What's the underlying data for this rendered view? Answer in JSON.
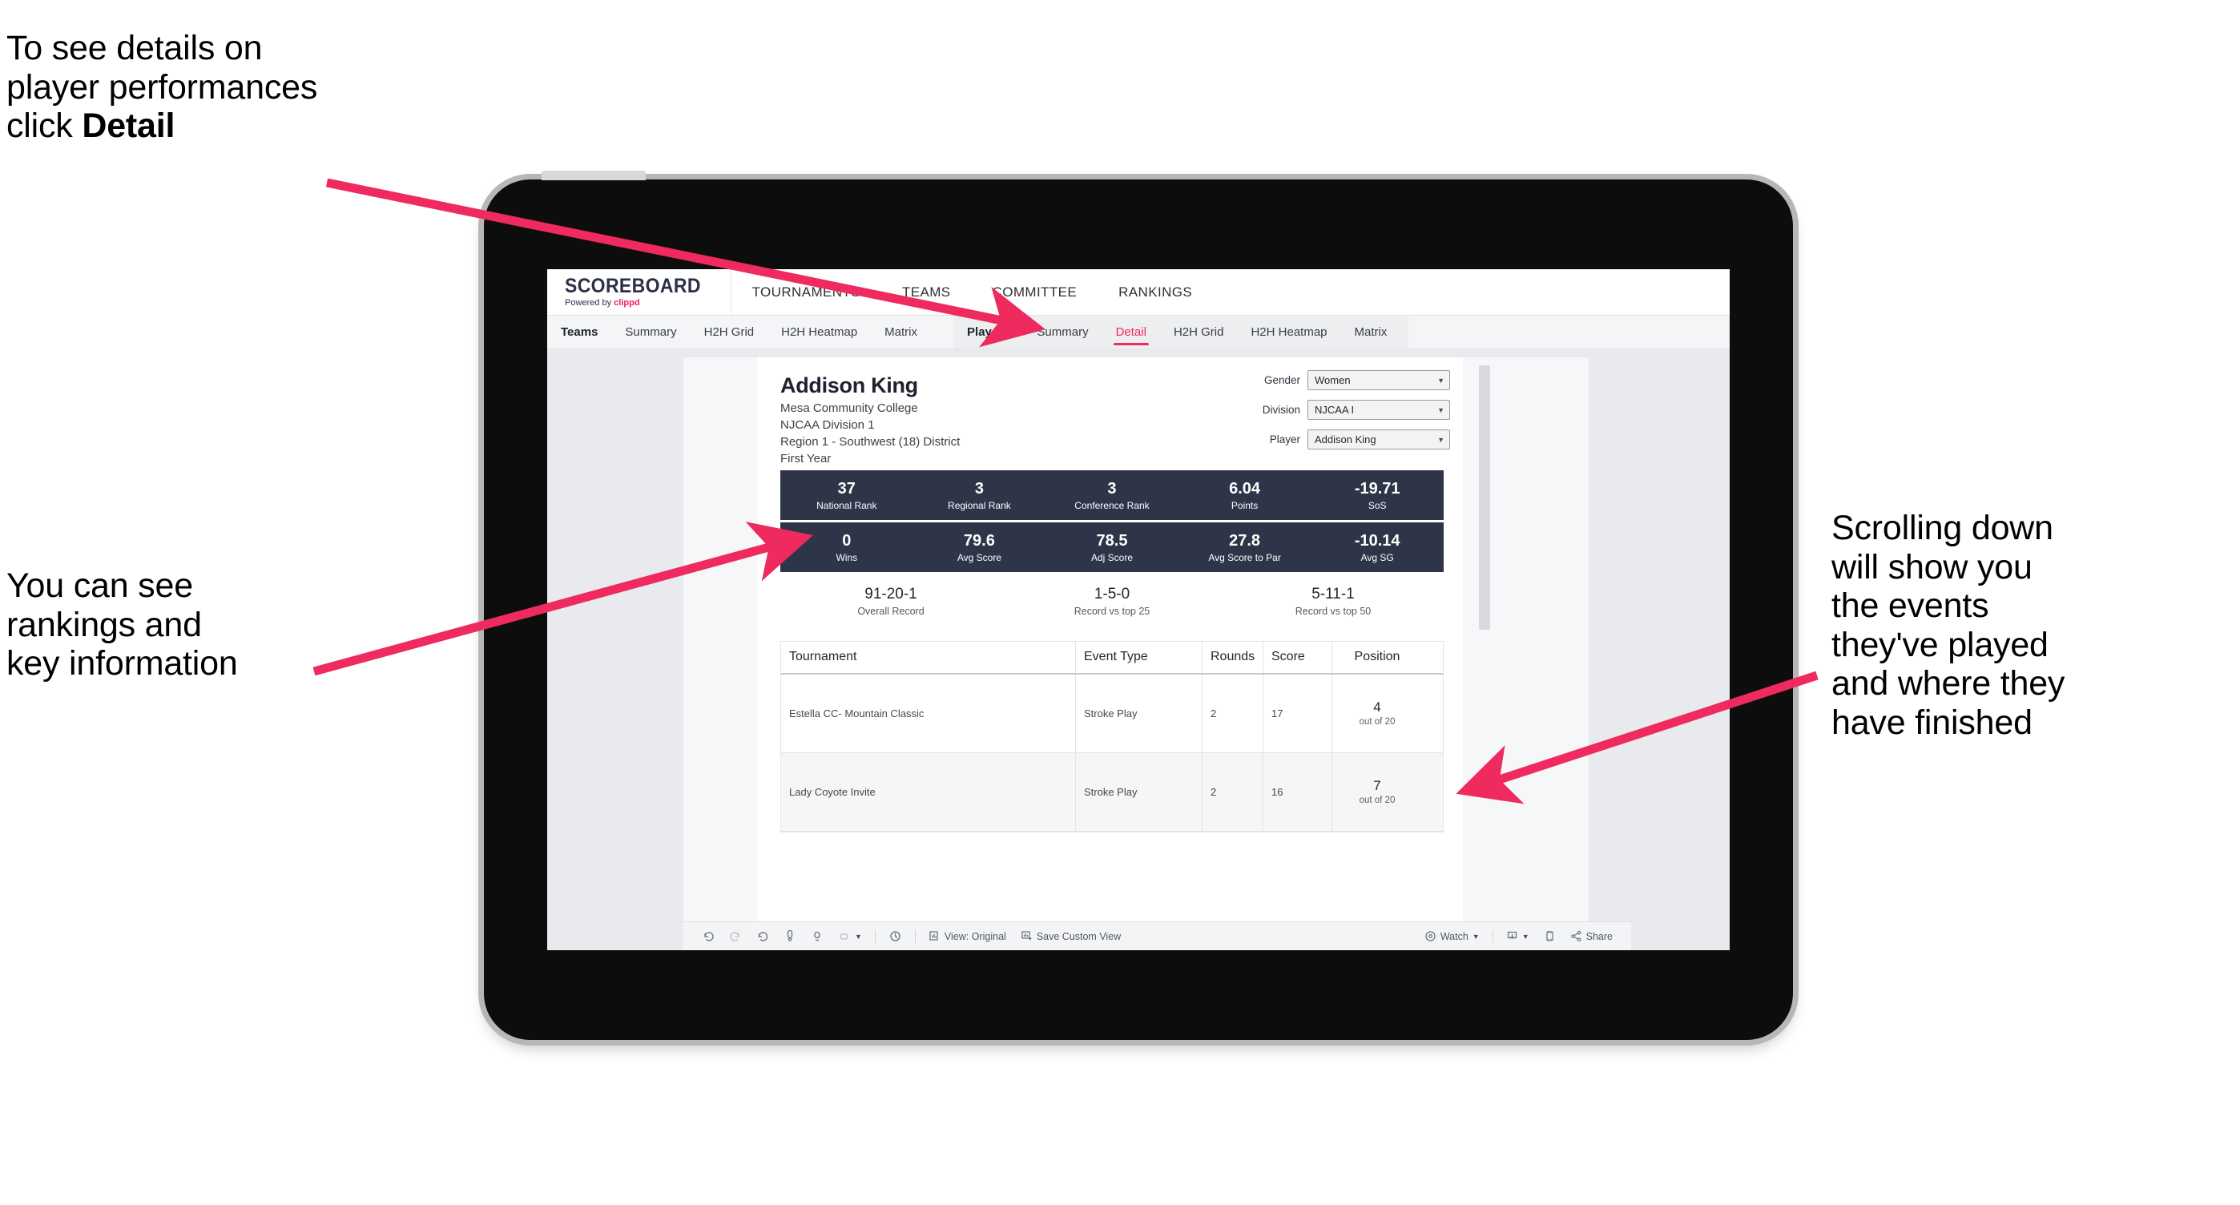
{
  "annotations": {
    "detail": "To see details on\nplayer performances\nclick ",
    "detail_bold": "Detail",
    "rankings": "You can see\nrankings and\nkey information",
    "scrolling": "Scrolling down\nwill show you\nthe events\nthey've played\nand where they\nhave finished"
  },
  "colors": {
    "accent_pink": "#ef2b5e",
    "navy": "#2e3548",
    "arrow": "#ee2a5f",
    "screen_bg": "#e8eaed"
  },
  "app": {
    "brand": {
      "title": "SCOREBOARD",
      "powered_prefix": "Powered by ",
      "powered_mark": "clippd"
    },
    "topnav": [
      "TOURNAMENTS",
      "TEAMS",
      "COMMITTEE",
      "RANKINGS"
    ],
    "subnav": {
      "group_one_label": "Teams",
      "group_one": [
        "Summary",
        "H2H Grid",
        "H2H Heatmap",
        "Matrix"
      ],
      "group_two_label": "Players",
      "group_two": [
        "Summary",
        "Detail",
        "H2H Grid",
        "H2H Heatmap",
        "Matrix"
      ],
      "active": "Detail"
    }
  },
  "player": {
    "name": "Addison King",
    "school": "Mesa Community College",
    "division": "NJCAA Division 1",
    "region": "Region 1 - Southwest (18) District",
    "year": "First Year"
  },
  "selectors": [
    {
      "label": "Gender",
      "value": "Women"
    },
    {
      "label": "Division",
      "value": "NJCAA I"
    },
    {
      "label": "Player",
      "value": "Addison King"
    }
  ],
  "stats_row1": [
    {
      "value": "37",
      "label": "National Rank"
    },
    {
      "value": "3",
      "label": "Regional Rank"
    },
    {
      "value": "3",
      "label": "Conference Rank"
    },
    {
      "value": "6.04",
      "label": "Points"
    },
    {
      "value": "-19.71",
      "label": "SoS"
    }
  ],
  "stats_row2": [
    {
      "value": "0",
      "label": "Wins"
    },
    {
      "value": "79.6",
      "label": "Avg Score"
    },
    {
      "value": "78.5",
      "label": "Adj Score"
    },
    {
      "value": "27.8",
      "label": "Avg Score to Par"
    },
    {
      "value": "-10.14",
      "label": "Avg SG"
    }
  ],
  "records": [
    {
      "value": "91-20-1",
      "label": "Overall Record"
    },
    {
      "value": "1-5-0",
      "label": "Record vs top 25"
    },
    {
      "value": "5-11-1",
      "label": "Record vs top 50"
    }
  ],
  "events_table": {
    "headers": [
      "Tournament",
      "Event Type",
      "Rounds",
      "Score",
      "Position"
    ],
    "rows": [
      {
        "tournament": "Estella CC- Mountain Classic",
        "event_type": "Stroke Play",
        "rounds": "2",
        "score": "17",
        "position": "4",
        "position_suffix": "out of 20"
      },
      {
        "tournament": "Lady Coyote Invite",
        "event_type": "Stroke Play",
        "rounds": "2",
        "score": "16",
        "position": "7",
        "position_suffix": "out of 20"
      }
    ]
  },
  "toolbar": {
    "view_label": "View: Original",
    "save_label": "Save Custom View",
    "watch_label": "Watch",
    "share_label": "Share"
  }
}
